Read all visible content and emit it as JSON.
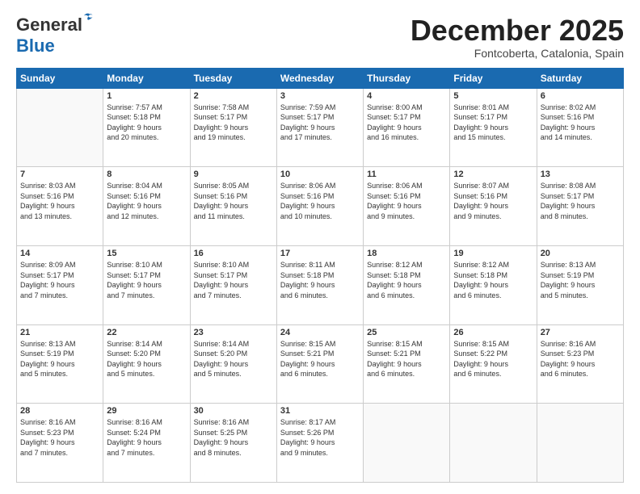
{
  "header": {
    "logo_line1": "General",
    "logo_line2": "Blue",
    "month": "December 2025",
    "location": "Fontcoberta, Catalonia, Spain"
  },
  "weekdays": [
    "Sunday",
    "Monday",
    "Tuesday",
    "Wednesday",
    "Thursday",
    "Friday",
    "Saturday"
  ],
  "weeks": [
    [
      {
        "day": "",
        "info": ""
      },
      {
        "day": "1",
        "info": "Sunrise: 7:57 AM\nSunset: 5:18 PM\nDaylight: 9 hours\nand 20 minutes."
      },
      {
        "day": "2",
        "info": "Sunrise: 7:58 AM\nSunset: 5:17 PM\nDaylight: 9 hours\nand 19 minutes."
      },
      {
        "day": "3",
        "info": "Sunrise: 7:59 AM\nSunset: 5:17 PM\nDaylight: 9 hours\nand 17 minutes."
      },
      {
        "day": "4",
        "info": "Sunrise: 8:00 AM\nSunset: 5:17 PM\nDaylight: 9 hours\nand 16 minutes."
      },
      {
        "day": "5",
        "info": "Sunrise: 8:01 AM\nSunset: 5:17 PM\nDaylight: 9 hours\nand 15 minutes."
      },
      {
        "day": "6",
        "info": "Sunrise: 8:02 AM\nSunset: 5:16 PM\nDaylight: 9 hours\nand 14 minutes."
      }
    ],
    [
      {
        "day": "7",
        "info": "Sunrise: 8:03 AM\nSunset: 5:16 PM\nDaylight: 9 hours\nand 13 minutes."
      },
      {
        "day": "8",
        "info": "Sunrise: 8:04 AM\nSunset: 5:16 PM\nDaylight: 9 hours\nand 12 minutes."
      },
      {
        "day": "9",
        "info": "Sunrise: 8:05 AM\nSunset: 5:16 PM\nDaylight: 9 hours\nand 11 minutes."
      },
      {
        "day": "10",
        "info": "Sunrise: 8:06 AM\nSunset: 5:16 PM\nDaylight: 9 hours\nand 10 minutes."
      },
      {
        "day": "11",
        "info": "Sunrise: 8:06 AM\nSunset: 5:16 PM\nDaylight: 9 hours\nand 9 minutes."
      },
      {
        "day": "12",
        "info": "Sunrise: 8:07 AM\nSunset: 5:16 PM\nDaylight: 9 hours\nand 9 minutes."
      },
      {
        "day": "13",
        "info": "Sunrise: 8:08 AM\nSunset: 5:17 PM\nDaylight: 9 hours\nand 8 minutes."
      }
    ],
    [
      {
        "day": "14",
        "info": "Sunrise: 8:09 AM\nSunset: 5:17 PM\nDaylight: 9 hours\nand 7 minutes."
      },
      {
        "day": "15",
        "info": "Sunrise: 8:10 AM\nSunset: 5:17 PM\nDaylight: 9 hours\nand 7 minutes."
      },
      {
        "day": "16",
        "info": "Sunrise: 8:10 AM\nSunset: 5:17 PM\nDaylight: 9 hours\nand 7 minutes."
      },
      {
        "day": "17",
        "info": "Sunrise: 8:11 AM\nSunset: 5:18 PM\nDaylight: 9 hours\nand 6 minutes."
      },
      {
        "day": "18",
        "info": "Sunrise: 8:12 AM\nSunset: 5:18 PM\nDaylight: 9 hours\nand 6 minutes."
      },
      {
        "day": "19",
        "info": "Sunrise: 8:12 AM\nSunset: 5:18 PM\nDaylight: 9 hours\nand 6 minutes."
      },
      {
        "day": "20",
        "info": "Sunrise: 8:13 AM\nSunset: 5:19 PM\nDaylight: 9 hours\nand 5 minutes."
      }
    ],
    [
      {
        "day": "21",
        "info": "Sunrise: 8:13 AM\nSunset: 5:19 PM\nDaylight: 9 hours\nand 5 minutes."
      },
      {
        "day": "22",
        "info": "Sunrise: 8:14 AM\nSunset: 5:20 PM\nDaylight: 9 hours\nand 5 minutes."
      },
      {
        "day": "23",
        "info": "Sunrise: 8:14 AM\nSunset: 5:20 PM\nDaylight: 9 hours\nand 5 minutes."
      },
      {
        "day": "24",
        "info": "Sunrise: 8:15 AM\nSunset: 5:21 PM\nDaylight: 9 hours\nand 6 minutes."
      },
      {
        "day": "25",
        "info": "Sunrise: 8:15 AM\nSunset: 5:21 PM\nDaylight: 9 hours\nand 6 minutes."
      },
      {
        "day": "26",
        "info": "Sunrise: 8:15 AM\nSunset: 5:22 PM\nDaylight: 9 hours\nand 6 minutes."
      },
      {
        "day": "27",
        "info": "Sunrise: 8:16 AM\nSunset: 5:23 PM\nDaylight: 9 hours\nand 6 minutes."
      }
    ],
    [
      {
        "day": "28",
        "info": "Sunrise: 8:16 AM\nSunset: 5:23 PM\nDaylight: 9 hours\nand 7 minutes."
      },
      {
        "day": "29",
        "info": "Sunrise: 8:16 AM\nSunset: 5:24 PM\nDaylight: 9 hours\nand 7 minutes."
      },
      {
        "day": "30",
        "info": "Sunrise: 8:16 AM\nSunset: 5:25 PM\nDaylight: 9 hours\nand 8 minutes."
      },
      {
        "day": "31",
        "info": "Sunrise: 8:17 AM\nSunset: 5:26 PM\nDaylight: 9 hours\nand 9 minutes."
      },
      {
        "day": "",
        "info": ""
      },
      {
        "day": "",
        "info": ""
      },
      {
        "day": "",
        "info": ""
      }
    ]
  ]
}
